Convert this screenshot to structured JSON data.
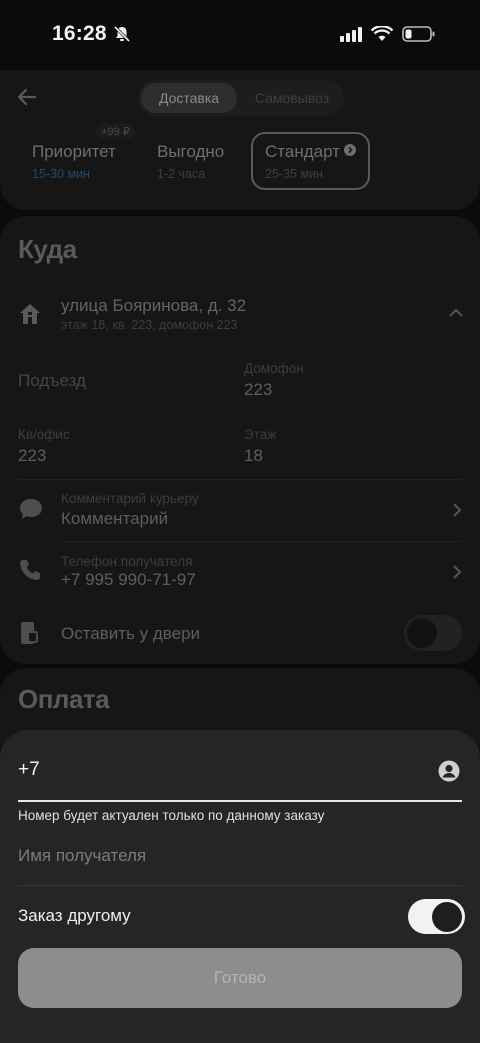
{
  "status": {
    "time": "16:28"
  },
  "delivery": {
    "tabs": {
      "delivery": "Доставка",
      "pickup": "Самовывоз"
    },
    "badge": "+99 ₽",
    "options": [
      {
        "title": "Приоритет",
        "sub": "15-30 мин"
      },
      {
        "title": "Выгодно",
        "sub": "1-2 часа"
      },
      {
        "title": "Стандарт",
        "sub": "25-35 мин"
      }
    ]
  },
  "where": {
    "title": "Куда",
    "address": "улица Бояринова, д. 32",
    "address_details": "этаж 18, кв. 223, домофон 223",
    "entrance_label": "Подъезд",
    "intercom_label": "Домофон",
    "intercom_value": "223",
    "apartment_label": "Кв/офис",
    "apartment_value": "223",
    "floor_label": "Этаж",
    "floor_value": "18",
    "comment_label": "Комментарий курьеру",
    "comment_value": "Комментарий",
    "phone_label": "Телефон получателя",
    "phone_value": "+7 995 990-71-97",
    "leave_door_label": "Оставить у двери"
  },
  "payment": {
    "title": "Оплата"
  },
  "sheet": {
    "phone_value": "+7",
    "hint": "Номер будет актуален только по данному заказу",
    "name_placeholder": "Имя получателя",
    "order_other_label": "Заказ другому",
    "done_label": "Готово"
  },
  "colors": {
    "accent_blue": "#2d6fa3",
    "sheet_bg": "#252525"
  }
}
